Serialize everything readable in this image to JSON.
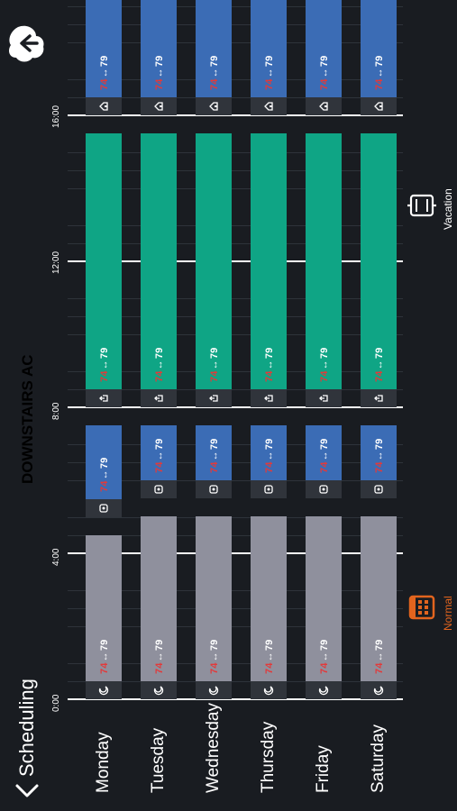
{
  "header": {
    "back_label": "Scheduling",
    "title": "DOWNSTAIRS AC",
    "cloud_back_icon": "cloud-back-icon"
  },
  "timeline": {
    "hour_labels": [
      "0:00",
      "4:00",
      "8:00",
      "12:00",
      "16:00"
    ]
  },
  "modes": {
    "normal_label": "Normal",
    "vacation_label": "Vacation",
    "active": "normal",
    "active_color": "#e2641e"
  },
  "colors": {
    "sleep": "#8f909d",
    "wake": "#3b6cb5",
    "leave": "#0fa585",
    "low_temp": "#e23a3a",
    "background": "#191c21"
  },
  "days": [
    {
      "name": "Monday",
      "periods": [
        {
          "type": "sleep",
          "start": "0:00",
          "low": "74",
          "high": "79",
          "icon": "moon-icon"
        },
        {
          "type": "wake",
          "start": "5:00",
          "low": "74",
          "high": "79",
          "icon": "sun-icon"
        },
        {
          "type": "leave",
          "start": "8:00",
          "low": "74",
          "high": "79",
          "icon": "leave-icon"
        },
        {
          "type": "wake",
          "start": "16:00",
          "low": "74",
          "high": "79",
          "icon": "home-icon"
        }
      ]
    },
    {
      "name": "Tuesday",
      "periods": [
        {
          "type": "sleep",
          "start": "0:00",
          "low": "74",
          "high": "79",
          "icon": "moon-icon"
        },
        {
          "type": "wake",
          "start": "5:30",
          "low": "74",
          "high": "79",
          "icon": "sun-icon"
        },
        {
          "type": "leave",
          "start": "8:00",
          "low": "74",
          "high": "79",
          "icon": "leave-icon"
        },
        {
          "type": "wake",
          "start": "16:00",
          "low": "74",
          "high": "79",
          "icon": "home-icon"
        }
      ]
    },
    {
      "name": "Wednesday",
      "periods": [
        {
          "type": "sleep",
          "start": "0:00",
          "low": "74",
          "high": "79",
          "icon": "moon-icon"
        },
        {
          "type": "wake",
          "start": "5:30",
          "low": "74",
          "high": "79",
          "icon": "sun-icon"
        },
        {
          "type": "leave",
          "start": "8:00",
          "low": "74",
          "high": "79",
          "icon": "leave-icon"
        },
        {
          "type": "wake",
          "start": "16:00",
          "low": "74",
          "high": "79",
          "icon": "home-icon"
        }
      ]
    },
    {
      "name": "Thursday",
      "periods": [
        {
          "type": "sleep",
          "start": "0:00",
          "low": "74",
          "high": "79",
          "icon": "moon-icon"
        },
        {
          "type": "wake",
          "start": "5:30",
          "low": "74",
          "high": "79",
          "icon": "sun-icon"
        },
        {
          "type": "leave",
          "start": "8:00",
          "low": "74",
          "high": "79",
          "icon": "leave-icon"
        },
        {
          "type": "wake",
          "start": "16:00",
          "low": "74",
          "high": "79",
          "icon": "home-icon"
        }
      ]
    },
    {
      "name": "Friday",
      "periods": [
        {
          "type": "sleep",
          "start": "0:00",
          "low": "74",
          "high": "79",
          "icon": "moon-icon"
        },
        {
          "type": "wake",
          "start": "5:30",
          "low": "74",
          "high": "79",
          "icon": "sun-icon"
        },
        {
          "type": "leave",
          "start": "8:00",
          "low": "74",
          "high": "79",
          "icon": "leave-icon"
        },
        {
          "type": "wake",
          "start": "16:00",
          "low": "74",
          "high": "79",
          "icon": "home-icon"
        }
      ]
    },
    {
      "name": "Saturday",
      "periods": [
        {
          "type": "sleep",
          "start": "0:00",
          "low": "74",
          "high": "79",
          "icon": "moon-icon"
        },
        {
          "type": "wake",
          "start": "5:30",
          "low": "74",
          "high": "79",
          "icon": "sun-icon"
        },
        {
          "type": "leave",
          "start": "8:00",
          "low": "74",
          "high": "79",
          "icon": "leave-icon"
        },
        {
          "type": "wake",
          "start": "16:00",
          "low": "74",
          "high": "79",
          "icon": "home-icon"
        }
      ]
    }
  ]
}
